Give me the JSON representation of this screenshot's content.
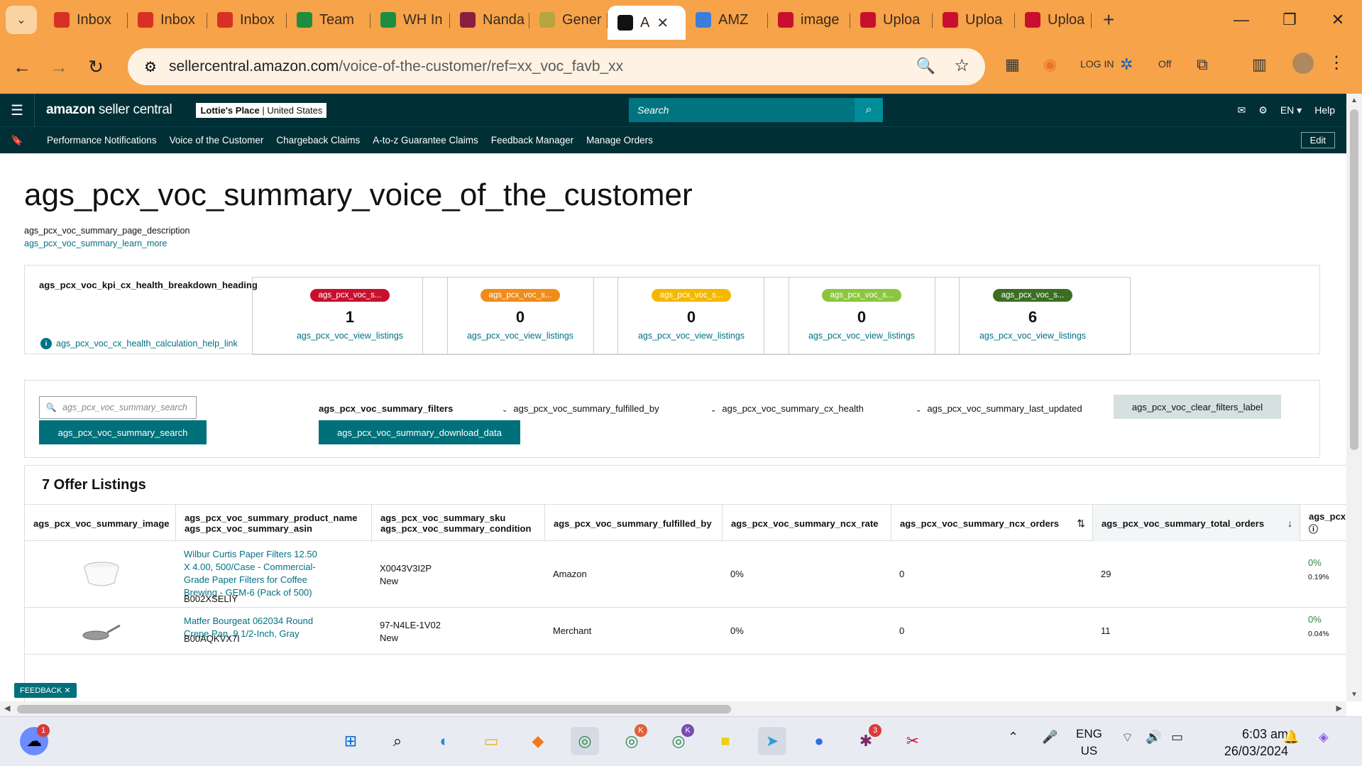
{
  "browser": {
    "tabs": [
      {
        "label": "Inbox",
        "icon": "gmail-icon",
        "color": "#d93025"
      },
      {
        "label": "Inbox",
        "icon": "gmail-icon",
        "color": "#d93025"
      },
      {
        "label": "Inbox",
        "icon": "gmail-icon",
        "color": "#d93025"
      },
      {
        "label": "Team",
        "icon": "sheets-icon",
        "color": "#1e8e3e"
      },
      {
        "label": "WH In",
        "icon": "sheets-icon",
        "color": "#1e8e3e"
      },
      {
        "label": "Nanda",
        "icon": "n-logo-icon",
        "color": "#8b1e3f"
      },
      {
        "label": "Gener",
        "icon": "leaf-icon",
        "color": "#b5a642"
      },
      {
        "label": "A",
        "icon": "amazon-icon",
        "color": "#111111",
        "active": true
      },
      {
        "label": "AMZ",
        "icon": "flag-icon",
        "color": "#3b7ddd"
      },
      {
        "label": "image",
        "icon": "shield-logo-icon",
        "color": "#c8102e"
      },
      {
        "label": "Uploa",
        "icon": "shield-logo-icon",
        "color": "#c8102e"
      },
      {
        "label": "Uploa",
        "icon": "shield-logo-icon",
        "color": "#c8102e"
      },
      {
        "label": "Uploa",
        "icon": "shield-logo-icon",
        "color": "#c8102e"
      }
    ],
    "url_host": "sellercentral.amazon.com",
    "url_path": "/voice-of-the-customer/ref=xx_voc_favb_xx",
    "theme_color": "#f6a34a"
  },
  "sc": {
    "logo_bold": "amazon",
    "logo_rest": " seller central",
    "store_name": "Lottie's Place",
    "store_region": "United States",
    "search_placeholder": "Search",
    "lang": "EN",
    "help": "Help",
    "nav_links": [
      "Performance Notifications",
      "Voice of the Customer",
      "Chargeback Claims",
      "A-to-z Guarantee Claims",
      "Feedback Manager",
      "Manage Orders"
    ],
    "edit": "Edit",
    "nav_color": "#002f36"
  },
  "page": {
    "title": "ags_pcx_voc_summary_voice_of_the_customer",
    "description": "ags_pcx_voc_summary_page_description",
    "learn_more": "ags_pcx_voc_summary_learn_more"
  },
  "kpi": {
    "heading": "ags_pcx_voc_kpi_cx_health_breakdown_heading",
    "help_link": "ags_pcx_voc_cx_health_calculation_help_link",
    "cards": [
      {
        "pill": "ags_pcx_voc_s...",
        "value": "1",
        "link": "ags_pcx_voc_view_listings",
        "color": "#c8102e"
      },
      {
        "pill": "ags_pcx_voc_s...",
        "value": "0",
        "link": "ags_pcx_voc_view_listings",
        "color": "#f08c1a"
      },
      {
        "pill": "ags_pcx_voc_s...",
        "value": "0",
        "link": "ags_pcx_voc_view_listings",
        "color": "#f5b800"
      },
      {
        "pill": "ags_pcx_voc_s...",
        "value": "0",
        "link": "ags_pcx_voc_view_listings",
        "color": "#8cc63f"
      },
      {
        "pill": "ags_pcx_voc_s...",
        "value": "6",
        "link": "ags_pcx_voc_view_listings",
        "color": "#3b6e22"
      }
    ]
  },
  "filters": {
    "search_placeholder": "ags_pcx_voc_summary_search",
    "search_button": "ags_pcx_voc_summary_search",
    "label": "ags_pcx_voc_summary_filters",
    "download": "ags_pcx_voc_summary_download_data",
    "fulfilled_by": "ags_pcx_voc_summary_fulfilled_by",
    "cx_health": "ags_pcx_voc_summary_cx_health",
    "last_updated": "ags_pcx_voc_summary_last_updated",
    "clear": "ags_pcx_voc_clear_filters_label"
  },
  "table": {
    "title": "7 Offer Listings",
    "headers": {
      "image": "ags_pcx_voc_summary_image",
      "product_name": "ags_pcx_voc_summary_product_name",
      "asin": "ags_pcx_voc_summary_asin",
      "sku": "ags_pcx_voc_summary_sku",
      "condition": "ags_pcx_voc_summary_condition",
      "fulfilled_by": "ags_pcx_voc_summary_fulfilled_by",
      "ncx_rate": "ags_pcx_voc_summary_ncx_rate",
      "ncx_orders": "ags_pcx_voc_summary_ncx_orders",
      "total_orders": "ags_pcx_voc_summary_total_orders",
      "extra": "ags_pcx"
    },
    "rows": [
      {
        "product_name": "Wilbur Curtis Paper Filters 12.50 X 4.00, 500/Case - Commercial-Grade Paper Filters for Coffee Brewing - GEM-6 (Pack of 500)",
        "asin": "B002XSELIY",
        "sku": "X0043V3I2P",
        "condition": "New",
        "fulfilled_by": "Amazon",
        "ncx_rate": "0%",
        "ncx_orders": "0",
        "total_orders": "29",
        "extra_pct": "0%",
        "extra_sub": "0.19%"
      },
      {
        "product_name": "Matfer Bourgeat 062034 Round Crepe Pan, 9 1/2-Inch, Gray",
        "asin": "B00AQKVX7I",
        "sku": "97-N4LE-1V02",
        "condition": "New",
        "fulfilled_by": "Merchant",
        "ncx_rate": "0%",
        "ncx_orders": "0",
        "total_orders": "11",
        "extra_pct": "0%",
        "extra_sub": "0.04%"
      }
    ]
  },
  "feedback": "FEEDBACK",
  "taskbar": {
    "lang_top": "ENG",
    "lang_bottom": "US",
    "time": "6:03 am",
    "date": "26/03/2024"
  }
}
